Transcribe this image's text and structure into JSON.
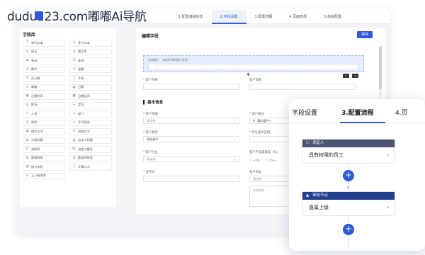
{
  "watermark": "dudu123.com嘟嘟Ai导航",
  "topbar": {
    "steps": [
      "1.配置基础信息",
      "2.字段设置",
      "3.配置流程",
      "4.页面布局",
      "5.高级配置"
    ]
  },
  "library": {
    "title": "字段库",
    "items": [
      {
        "label": "单行文本",
        "icon": "text-icon",
        "glyph": "T"
      },
      {
        "label": "多行文本",
        "icon": "multiline-icon",
        "glyph": "≡"
      },
      {
        "label": "网址",
        "icon": "link-icon",
        "glyph": "⊘"
      },
      {
        "label": "富文本",
        "icon": "rich-text-icon",
        "glyph": "A"
      },
      {
        "label": "单选",
        "icon": "radio-icon",
        "glyph": "◉"
      },
      {
        "label": "多选",
        "icon": "checkbox-icon",
        "glyph": "☑"
      },
      {
        "label": "数字",
        "icon": "number-icon",
        "glyph": "#"
      },
      {
        "label": "金额",
        "icon": "money-icon",
        "glyph": "¥"
      },
      {
        "label": "百分数",
        "icon": "percent-icon",
        "glyph": "%"
      },
      {
        "label": "手机",
        "icon": "phone-icon",
        "glyph": "▯"
      },
      {
        "label": "邮箱",
        "icon": "mail-icon",
        "glyph": "✉"
      },
      {
        "label": "日期",
        "icon": "calendar-icon",
        "glyph": "▦"
      },
      {
        "label": "日期时间",
        "icon": "datetime-icon",
        "glyph": "▦"
      },
      {
        "label": "日期区间",
        "icon": "date-range-icon",
        "glyph": "▦"
      },
      {
        "label": "地址",
        "icon": "location-icon",
        "glyph": "◎"
      },
      {
        "label": "定位",
        "icon": "pin-icon",
        "glyph": "⌖"
      },
      {
        "label": "人员",
        "icon": "person-icon",
        "glyph": "♙"
      },
      {
        "label": "部门",
        "icon": "department-icon",
        "glyph": "⌂"
      },
      {
        "label": "附件",
        "icon": "attachment-icon",
        "glyph": "⎘"
      },
      {
        "label": "手写签名",
        "icon": "signature-icon",
        "glyph": "✎"
      },
      {
        "label": "图片文字",
        "icon": "image-text-icon",
        "glyph": "▣"
      },
      {
        "label": "说明文字",
        "icon": "description-icon",
        "glyph": "☰"
      },
      {
        "label": "分组标题",
        "icon": "group-title-icon",
        "glyph": "▤"
      },
      {
        "label": "自定义标题",
        "icon": "custom-title-icon",
        "glyph": "▤"
      },
      {
        "label": "关联表",
        "icon": "relation-icon",
        "glyph": "⇄"
      },
      {
        "label": "自定义编号",
        "icon": "serial-icon",
        "glyph": "№"
      },
      {
        "label": "数据关联",
        "icon": "data-link-icon",
        "glyph": "⊞"
      },
      {
        "label": "数据关联选",
        "icon": "data-select-icon",
        "glyph": "⊞"
      },
      {
        "label": "统计字段",
        "icon": "stats-icon",
        "glyph": "▥"
      },
      {
        "label": "计算公式",
        "icon": "formula-icon",
        "glyph": "ƒ"
      },
      {
        "label": "上下级关系",
        "icon": "hierarchy-icon",
        "glyph": "⋔"
      }
    ]
  },
  "form": {
    "title": "编辑字段",
    "save_label": "保存",
    "selected_field_label": "关联客户 （来自CRM/客户信息）",
    "fields": {
      "customer_name_label": "* 客户名称",
      "customer_short_label": "客户简称",
      "section_title": "基本信息",
      "source_label": "* 客户来源",
      "source_placeholder": "请选择",
      "level_label": "* 客户级别",
      "level_value": "A（重点客户）",
      "type_label": "* 客户类型",
      "type_value": "潜在客户",
      "contact_label": "* 所在省市区域",
      "industry_label": "* 客户行业",
      "industry_placeholder": "请选择",
      "quality_label": "客户产品满意度（%）",
      "radio_a": "○ ~5%",
      "radio_b": "○ 5%~",
      "owner_label": "* 业务员",
      "address_label": "客户地址",
      "address_placeholder": "请选择",
      "detail_placeholder": "详细地址"
    }
  },
  "card": {
    "tabs": [
      "字段设置",
      "3.配置流程",
      "4.页"
    ],
    "nodes": [
      {
        "head": "发起人",
        "body": "具有权限的员工",
        "color": "#4a5470",
        "icon": "user-icon",
        "glyph": "☐"
      },
      {
        "head": "审批节点",
        "body": "直属上级",
        "color": "#23408f",
        "icon": "approval-icon",
        "glyph": "▲"
      }
    ]
  },
  "colors": {
    "accent": "#2d5bd8",
    "node_start": "#4a5470",
    "node_approval": "#23408f"
  }
}
